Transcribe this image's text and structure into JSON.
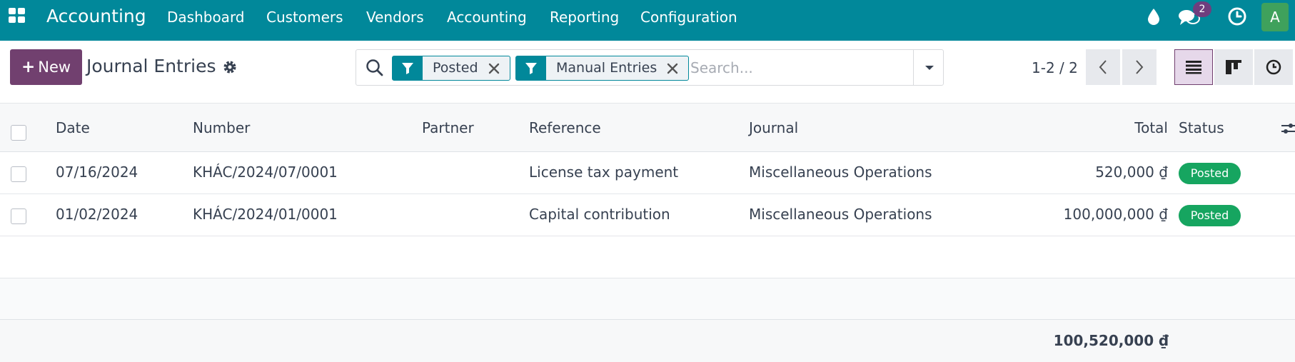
{
  "app": {
    "name": "Accounting"
  },
  "menu": [
    "Dashboard",
    "Customers",
    "Vendors",
    "Accounting",
    "Reporting",
    "Configuration"
  ],
  "systray": {
    "messages_count": "2",
    "user_initial": "A"
  },
  "control_panel": {
    "new_label": "New",
    "title": "Journal Entries",
    "facets": [
      "Posted",
      "Manual Entries"
    ],
    "search_placeholder": "Search...",
    "pager": "1-2 / 2"
  },
  "columns": [
    "Date",
    "Number",
    "Partner",
    "Reference",
    "Journal",
    "Total",
    "Status"
  ],
  "rows": [
    {
      "date": "07/16/2024",
      "number": "KHÁC/2024/07/0001",
      "partner": "",
      "reference": "License tax payment",
      "journal": "Miscellaneous Operations",
      "total": "520,000 ₫",
      "status": "Posted"
    },
    {
      "date": "01/02/2024",
      "number": "KHÁC/2024/01/0001",
      "partner": "",
      "reference": "Capital contribution",
      "journal": "Miscellaneous Operations",
      "total": "100,000,000 ₫",
      "status": "Posted"
    }
  ],
  "footer": {
    "total": "100,520,000 ₫"
  },
  "colors": {
    "navbar": "#01889a",
    "primary": "#71406f",
    "status_posted": "#16a560"
  },
  "icons": [
    "apps-icon",
    "drop-icon",
    "chat-icon",
    "clock-icon",
    "gear-icon",
    "search-icon",
    "filter-icon",
    "close-icon",
    "caret-down-icon",
    "chevron-left-icon",
    "chevron-right-icon",
    "list-view-icon",
    "kanban-view-icon",
    "activity-view-icon",
    "optional-columns-icon"
  ]
}
